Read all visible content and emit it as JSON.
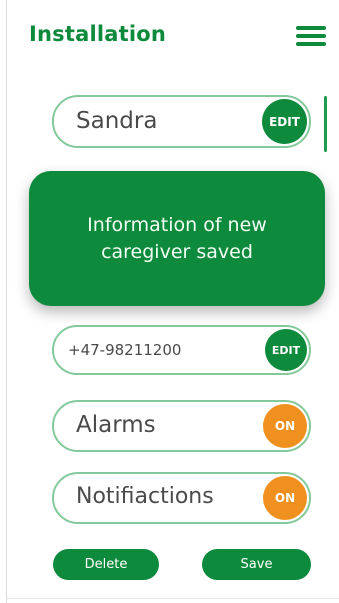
{
  "header": {
    "title": "Installation",
    "menu_icon": "hamburger-menu-icon"
  },
  "form": {
    "name": {
      "value": "Sandra",
      "action": "EDIT"
    },
    "phone": {
      "value": "+47-98211200",
      "action": "EDIT"
    },
    "alarms": {
      "label": "Alarms",
      "state": "ON"
    },
    "notifications": {
      "label": "Notifiactions",
      "state": "ON"
    }
  },
  "toast": {
    "message": "Information of new caregiver saved"
  },
  "actions": {
    "delete_label": "Delete",
    "save_label": "Save"
  },
  "colors": {
    "primary": "#0e8a3c",
    "accent": "#f0901e",
    "field_border": "#84c99c"
  }
}
